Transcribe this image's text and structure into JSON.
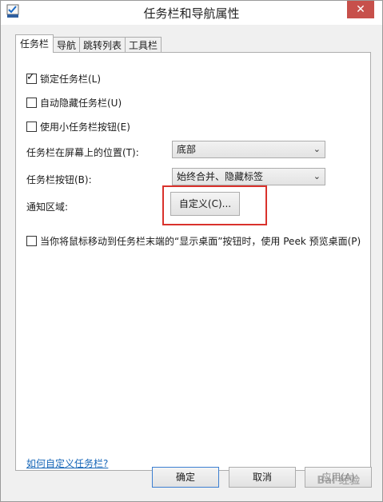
{
  "window": {
    "title": "任务栏和导航属性",
    "close_glyph": "✕"
  },
  "tabs": [
    {
      "label": "任务栏",
      "active": true
    },
    {
      "label": "导航",
      "active": false
    },
    {
      "label": "跳转列表",
      "active": false
    },
    {
      "label": "工具栏",
      "active": false
    }
  ],
  "options": {
    "lock_taskbar": {
      "label": "锁定任务栏(L)",
      "checked": true
    },
    "autohide": {
      "label": "自动隐藏任务栏(U)",
      "checked": false
    },
    "small_buttons": {
      "label": "使用小任务栏按钮(E)",
      "checked": false
    },
    "peek": {
      "label": "当你将鼠标移动到任务栏末端的“显示桌面”按钮时，使用 Peek 预览桌面(P)",
      "checked": false
    }
  },
  "position": {
    "label": "任务栏在屏幕上的位置(T):",
    "value": "底部"
  },
  "buttons_combine": {
    "label": "任务栏按钮(B):",
    "value": "始终合并、隐藏标签"
  },
  "notification": {
    "label": "通知区域:",
    "customize_label": "自定义(C)..."
  },
  "help_link": "如何自定义任务栏?",
  "footer": {
    "ok_label": "确定",
    "cancel_label": "取消",
    "apply_label": "应用(A)"
  },
  "watermark": "Bai 经验"
}
